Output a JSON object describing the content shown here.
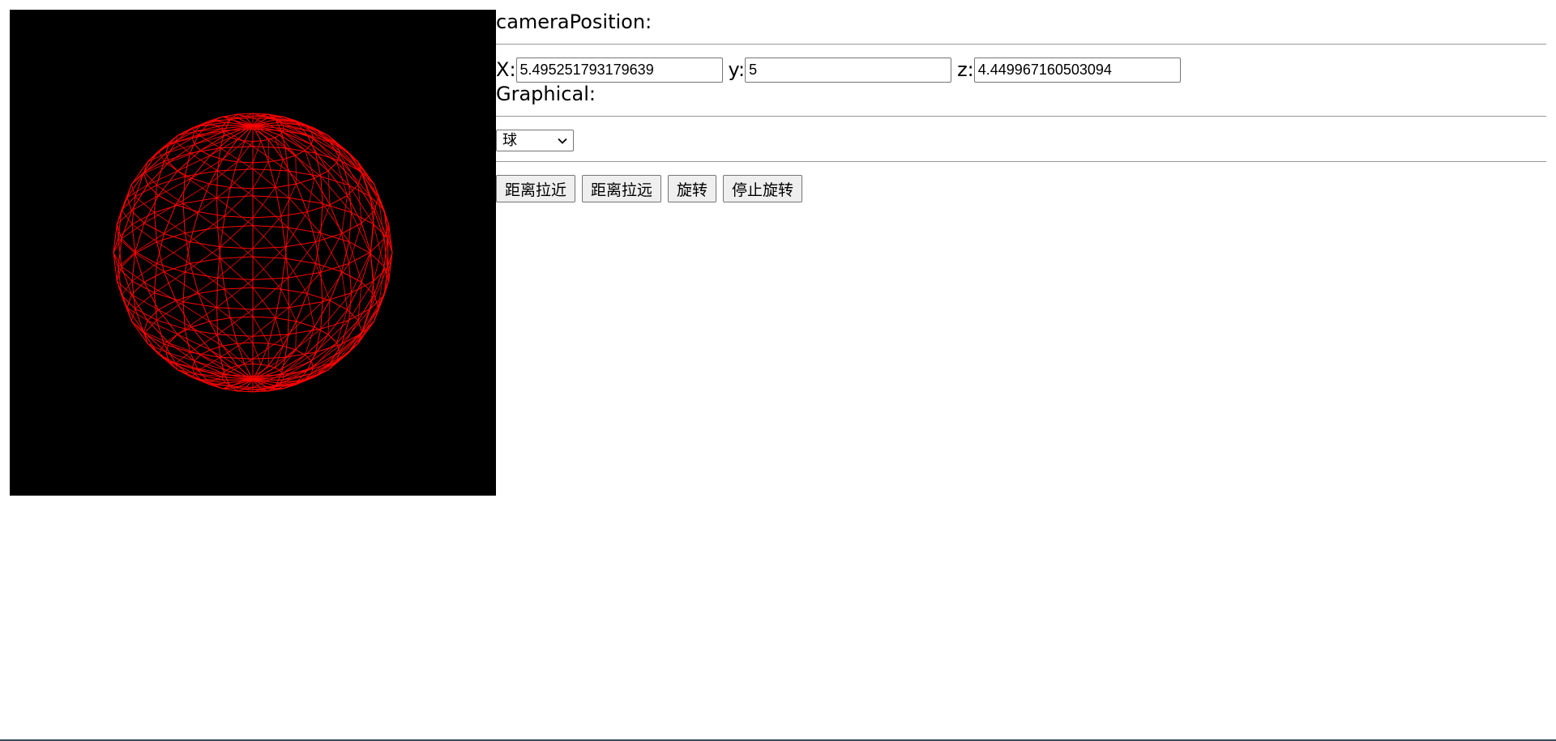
{
  "scene": {
    "background_color": "#000000",
    "mesh_color": "#ff0000",
    "shape": "sphere-wireframe"
  },
  "camera_position": {
    "heading": "cameraPosition:",
    "x_label": "X:",
    "x_value": "5.495251793179639",
    "y_label": "y:",
    "y_value": "5",
    "z_label": "z:",
    "z_value": "4.449967160503094"
  },
  "graphical": {
    "heading": "Graphical:",
    "selected": "球"
  },
  "toolbar": {
    "zoom_in_label": "距离拉近",
    "zoom_out_label": "距离拉远",
    "rotate_label": "旋转",
    "stop_rotate_label": "停止旋转"
  }
}
